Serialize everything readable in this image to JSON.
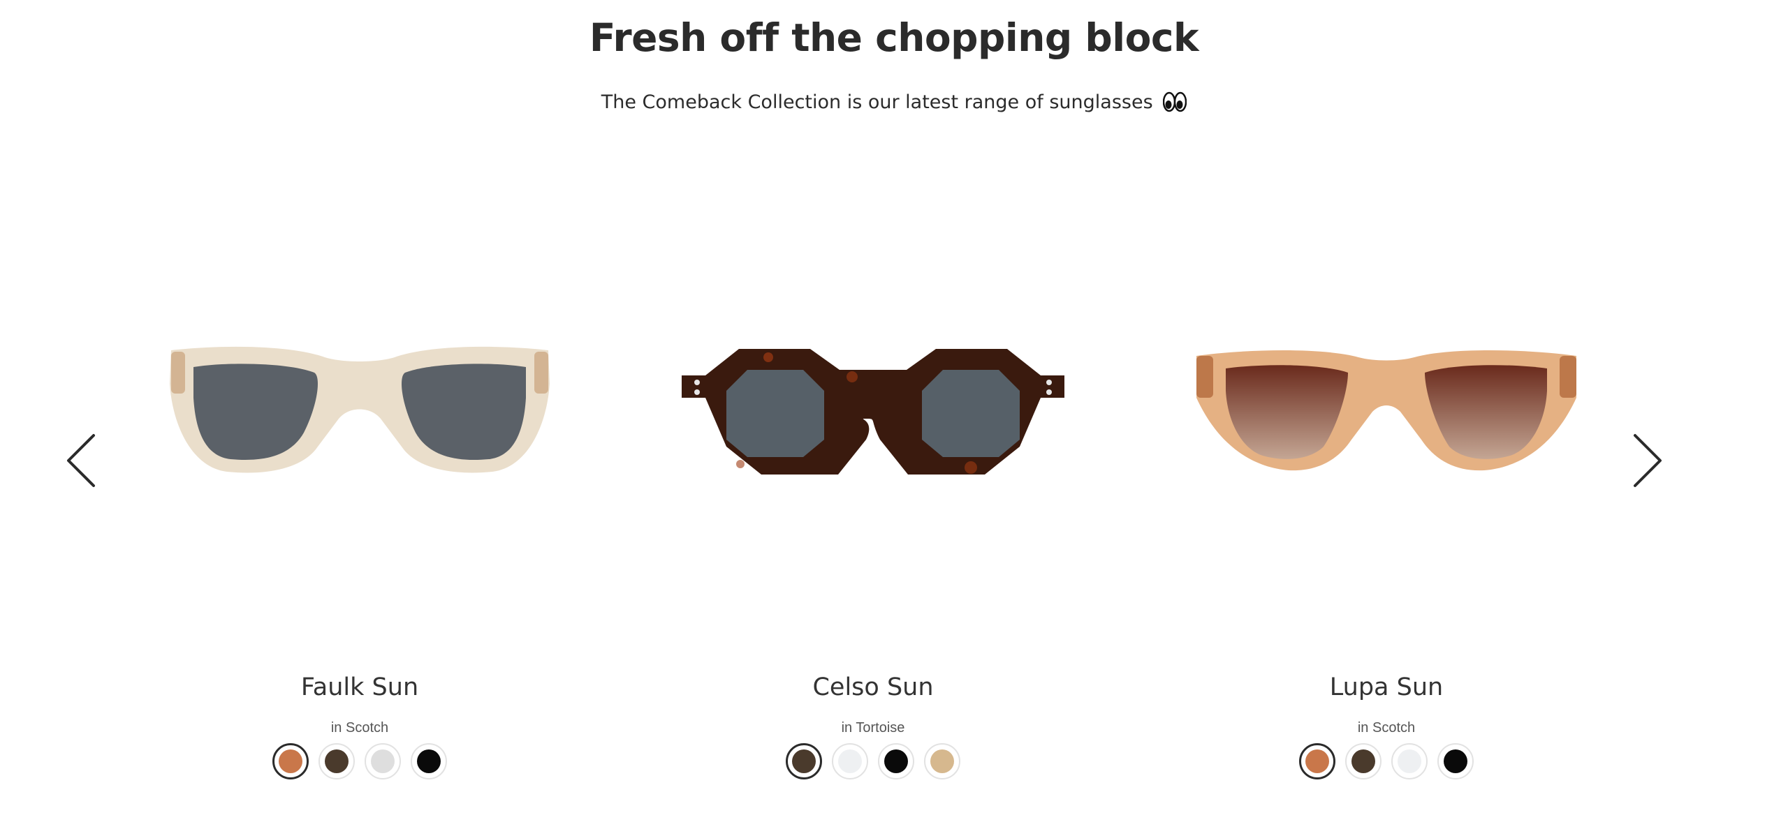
{
  "section": {
    "title": "Fresh off the chopping block",
    "subtitle": "The Comeback Collection is our latest range of sunglasses",
    "subtitle_emoji": "eyes-emoji"
  },
  "carousel": {
    "prev_icon": "chevron-left-icon",
    "next_icon": "chevron-right-icon",
    "products": [
      {
        "name": "Faulk Sun",
        "variant": "in Scotch",
        "frame_color": "#e9dcc8",
        "lens_color": "#5b6168",
        "selected_swatch": 0,
        "swatches": [
          {
            "name": "scotch",
            "color": "#c9774a"
          },
          {
            "name": "tortoise",
            "color": "#4a3a2c"
          },
          {
            "name": "crystal",
            "color": "#dedede"
          },
          {
            "name": "black",
            "color": "#0a0a0a"
          }
        ]
      },
      {
        "name": "Celso Sun",
        "variant": "in Tortoise",
        "frame_color": "#3a1a0e",
        "lens_color": "#566068",
        "selected_swatch": 0,
        "swatches": [
          {
            "name": "tortoise",
            "color": "#4a3a2c"
          },
          {
            "name": "crystal",
            "color": "#eef0f2"
          },
          {
            "name": "black",
            "color": "#0a0a0a"
          },
          {
            "name": "honey",
            "color": "#d6b88e"
          }
        ]
      },
      {
        "name": "Lupa Sun",
        "variant": "in Scotch",
        "frame_color": "#e4ad7c",
        "lens_color": "#7a3b28",
        "selected_swatch": 0,
        "swatches": [
          {
            "name": "scotch",
            "color": "#c9774a"
          },
          {
            "name": "tortoise",
            "color": "#4a3a2c"
          },
          {
            "name": "crystal",
            "color": "#eef0f2"
          },
          {
            "name": "black",
            "color": "#0a0a0a"
          }
        ]
      }
    ]
  }
}
